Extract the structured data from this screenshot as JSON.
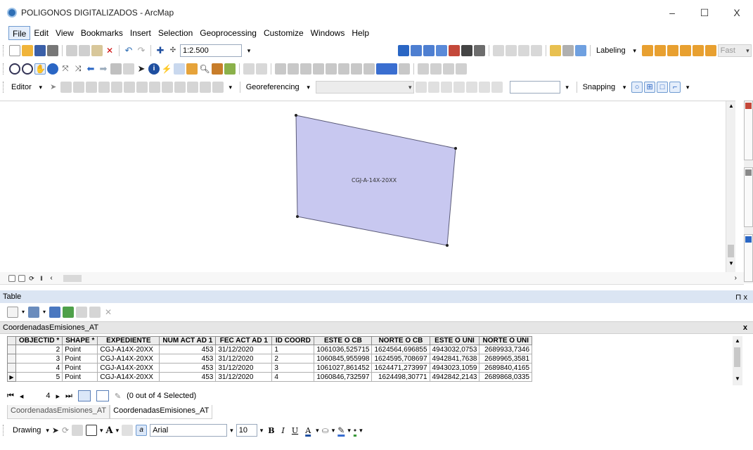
{
  "window": {
    "title": "POLIGONOS DIGITALIZADOS - ArcMap",
    "minimize": "–",
    "maximize": "☐",
    "close": "X"
  },
  "menu": [
    "File",
    "Edit",
    "View",
    "Bookmarks",
    "Insert",
    "Selection",
    "Geoprocessing",
    "Customize",
    "Windows",
    "Help"
  ],
  "toolbars": {
    "scale": "1:2.500",
    "labeling": "Labeling",
    "fast": "Fast",
    "editor": "Editor",
    "georeferencing": "Georeferencing",
    "snapping": "Snapping"
  },
  "map": {
    "polygon_label": "CGJ-A-14X-20XX",
    "fill_color": "#c8c8f0",
    "outline_color": "#5a5a78"
  },
  "table_pane": {
    "title": "Table",
    "pin": "⊓ x",
    "table_name": "CoordenadasEmisiones_AT",
    "close": "x",
    "columns": [
      "OBJECTID *",
      "SHAPE *",
      "EXPEDIENTE",
      "NUM ACT AD 1",
      "FEC ACT AD 1",
      "ID COORD",
      "ESTE O CB",
      "NORTE O CB",
      "ESTE O UNI",
      "NORTE O UNI"
    ],
    "rows": [
      [
        "2",
        "Point",
        "CGJ-A14X-20XX",
        "453",
        "31/12/2020",
        "1",
        "1061036,525715",
        "1624564,696855",
        "4943032,0753",
        "2689933,7346"
      ],
      [
        "3",
        "Point",
        "CGJ-A14X-20XX",
        "453",
        "31/12/2020",
        "2",
        "1060845,955998",
        "1624595,708697",
        "4942841,7638",
        "2689965,3581"
      ],
      [
        "4",
        "Point",
        "CGJ-A14X-20XX",
        "453",
        "31/12/2020",
        "3",
        "1061027,861452",
        "1624471,273997",
        "4943023,1059",
        "2689840,4165"
      ],
      [
        "5",
        "Point",
        "CGJ-A14X-20XX",
        "453",
        "31/12/2020",
        "4",
        "1060846,732597",
        "1624498,30771",
        "4942842,2143",
        "2689868,0335"
      ]
    ],
    "current_record": "4",
    "selection_status": "(0 out of 4 Selected)",
    "bottom_tabs": [
      "CoordenadasEmisiones_AT",
      "CoordenadasEmisiones_AT"
    ]
  },
  "drawing": {
    "label": "Drawing",
    "font_name": "Arial",
    "font_size": "10",
    "bold": "B",
    "italic": "I",
    "underline": "U",
    "text_a": "A"
  },
  "colors": {
    "accent": "#2f6fb5",
    "table_header_bg": "#dbe5f3"
  }
}
